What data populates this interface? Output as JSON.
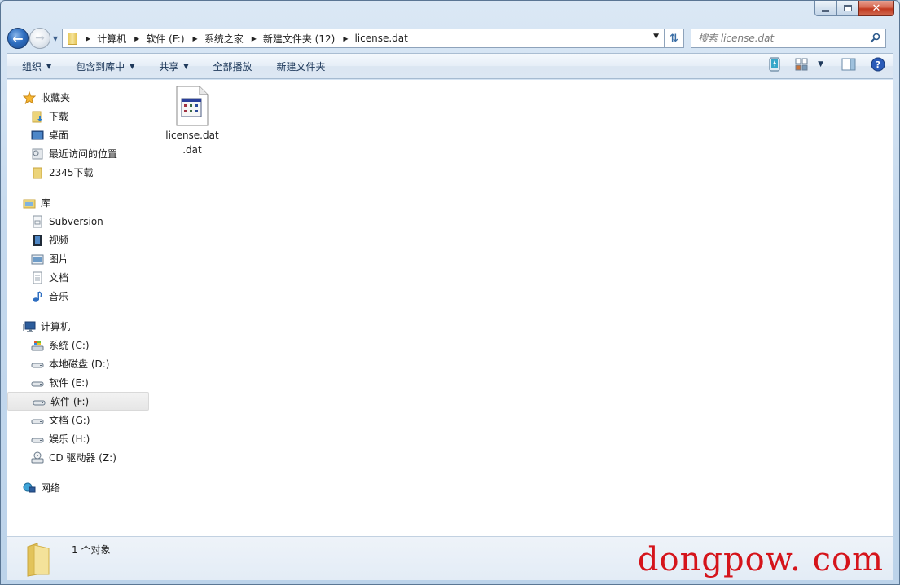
{
  "window": {
    "caption_buttons": {
      "minimize": "minimize",
      "maximize": "maximize",
      "close": "✕"
    }
  },
  "nav": {
    "back_icon": "back-arrow-icon",
    "forward_icon": "forward-arrow-icon",
    "breadcrumb": [
      "计算机",
      "软件 (F:)",
      "系统之家",
      "新建文件夹 (12)",
      "license.dat"
    ],
    "search_placeholder": "搜索 license.dat"
  },
  "toolbar": {
    "buttons": [
      {
        "label": "组织",
        "dropdown": true
      },
      {
        "label": "包含到库中",
        "dropdown": true
      },
      {
        "label": "共享",
        "dropdown": true
      },
      {
        "label": "全部播放",
        "dropdown": false
      },
      {
        "label": "新建文件夹",
        "dropdown": false
      }
    ]
  },
  "sidebar": {
    "groups": [
      {
        "header": "收藏夹",
        "icon": "star-icon",
        "items": [
          {
            "label": "下载",
            "icon": "downloads-folder-icon"
          },
          {
            "label": "桌面",
            "icon": "desktop-icon"
          },
          {
            "label": "最近访问的位置",
            "icon": "recent-places-icon"
          },
          {
            "label": "2345下载",
            "icon": "folder-icon"
          }
        ]
      },
      {
        "header": "库",
        "icon": "library-icon",
        "items": [
          {
            "label": "Subversion",
            "icon": "document-library-icon"
          },
          {
            "label": "视频",
            "icon": "video-icon"
          },
          {
            "label": "图片",
            "icon": "pictures-icon"
          },
          {
            "label": "文档",
            "icon": "documents-icon"
          },
          {
            "label": "音乐",
            "icon": "music-icon"
          }
        ]
      },
      {
        "header": "计算机",
        "icon": "computer-icon",
        "items": [
          {
            "label": "系统 (C:)",
            "icon": "system-drive-icon"
          },
          {
            "label": "本地磁盘 (D:)",
            "icon": "drive-icon"
          },
          {
            "label": "软件 (E:)",
            "icon": "drive-icon"
          },
          {
            "label": "软件 (F:)",
            "icon": "drive-icon",
            "selected": true
          },
          {
            "label": "文档 (G:)",
            "icon": "drive-icon"
          },
          {
            "label": "娱乐 (H:)",
            "icon": "drive-icon"
          },
          {
            "label": "CD 驱动器 (Z:)",
            "icon": "cd-drive-icon"
          }
        ]
      },
      {
        "header": "网络",
        "icon": "network-icon",
        "items": []
      }
    ]
  },
  "content": {
    "files": [
      {
        "name_line1": "license.dat",
        "name_line2": ".dat",
        "icon": "dat-file-icon"
      }
    ]
  },
  "status": {
    "text": "1 个对象"
  },
  "watermark": "dongpow. com"
}
